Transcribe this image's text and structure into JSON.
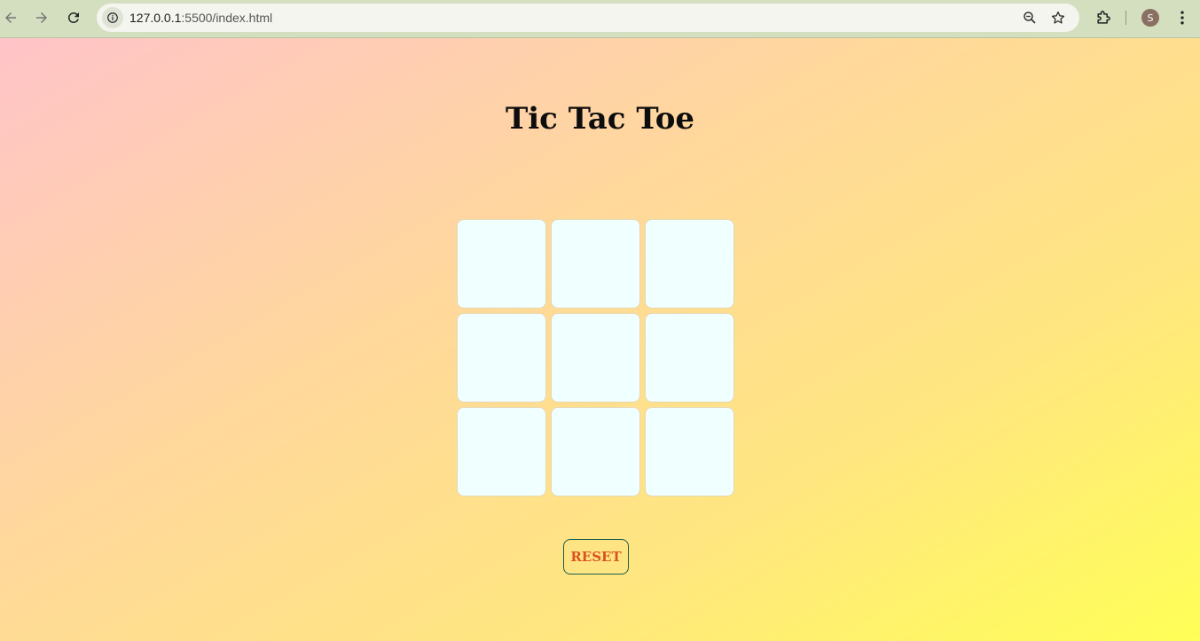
{
  "browser": {
    "url_host": "127.0.0.1",
    "url_path": ":5500/index.html",
    "profile_initial": "S",
    "icons": {
      "back": "arrow-left-icon",
      "forward": "arrow-right-icon",
      "reload": "reload-icon",
      "site_info": "info-icon",
      "zoom": "zoom-icon",
      "bookmark": "star-icon",
      "extensions": "puzzle-icon",
      "menu": "kebab-menu-icon"
    }
  },
  "page": {
    "title": "Tic Tac Toe",
    "board": {
      "cells": [
        "",
        "",
        "",
        "",
        "",
        "",
        "",
        "",
        ""
      ]
    },
    "reset_label": "RESET",
    "colors": {
      "cell_background": "#f0ffff",
      "reset_text": "#d9531e",
      "reset_border": "#1b5e4a",
      "gradient_start": "#ffc4c8",
      "gradient_end": "#ffff57"
    }
  }
}
